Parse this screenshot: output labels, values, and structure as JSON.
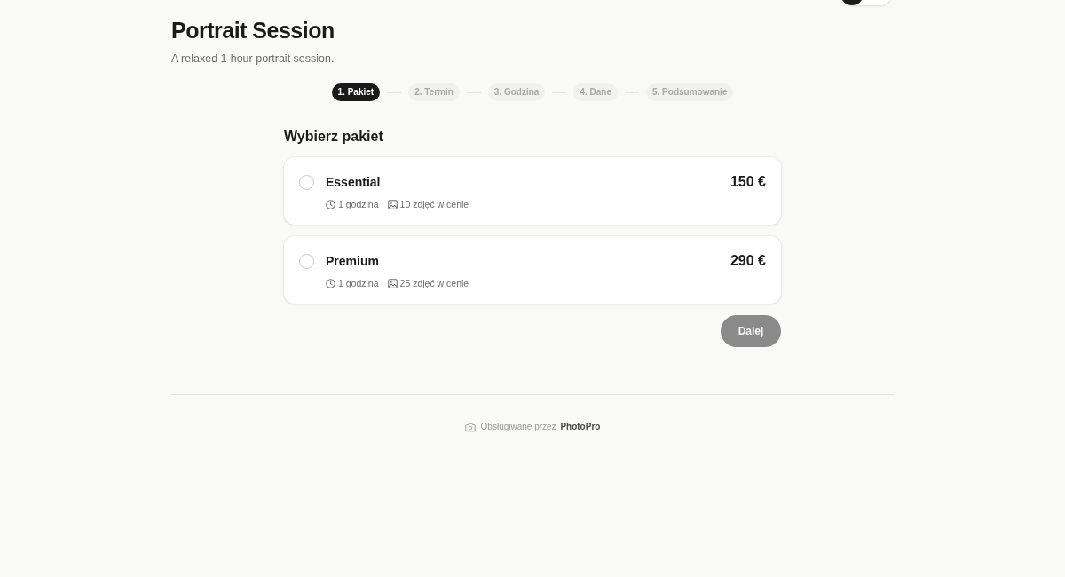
{
  "header": {
    "title": "Portrait Session",
    "subtitle": "A relaxed 1-hour portrait session.",
    "toggle": {
      "on": false
    }
  },
  "steps": [
    {
      "label": "1. Pakiet",
      "selected": true
    },
    {
      "label": "2. Termin",
      "selected": false
    },
    {
      "label": "3. Godzina",
      "selected": false
    },
    {
      "label": "4. Dane",
      "selected": false
    },
    {
      "label": "5. Podsumowanie",
      "selected": false
    }
  ],
  "package_picker": {
    "heading": "Wybierz pakiet",
    "packages": [
      {
        "name": "Essential",
        "price": "150 €",
        "duration": "1 godzina",
        "photos": "10 zdjęć w cenie",
        "selected": false
      },
      {
        "name": "Premium",
        "price": "290 €",
        "duration": "1 godzina",
        "photos": "25 zdjęć w cenie",
        "selected": false
      }
    ]
  },
  "next_button": {
    "label": "Dalej",
    "disabled": true
  },
  "footer": {
    "text": "Obsługiwane przez **PhotoPro**"
  }
}
